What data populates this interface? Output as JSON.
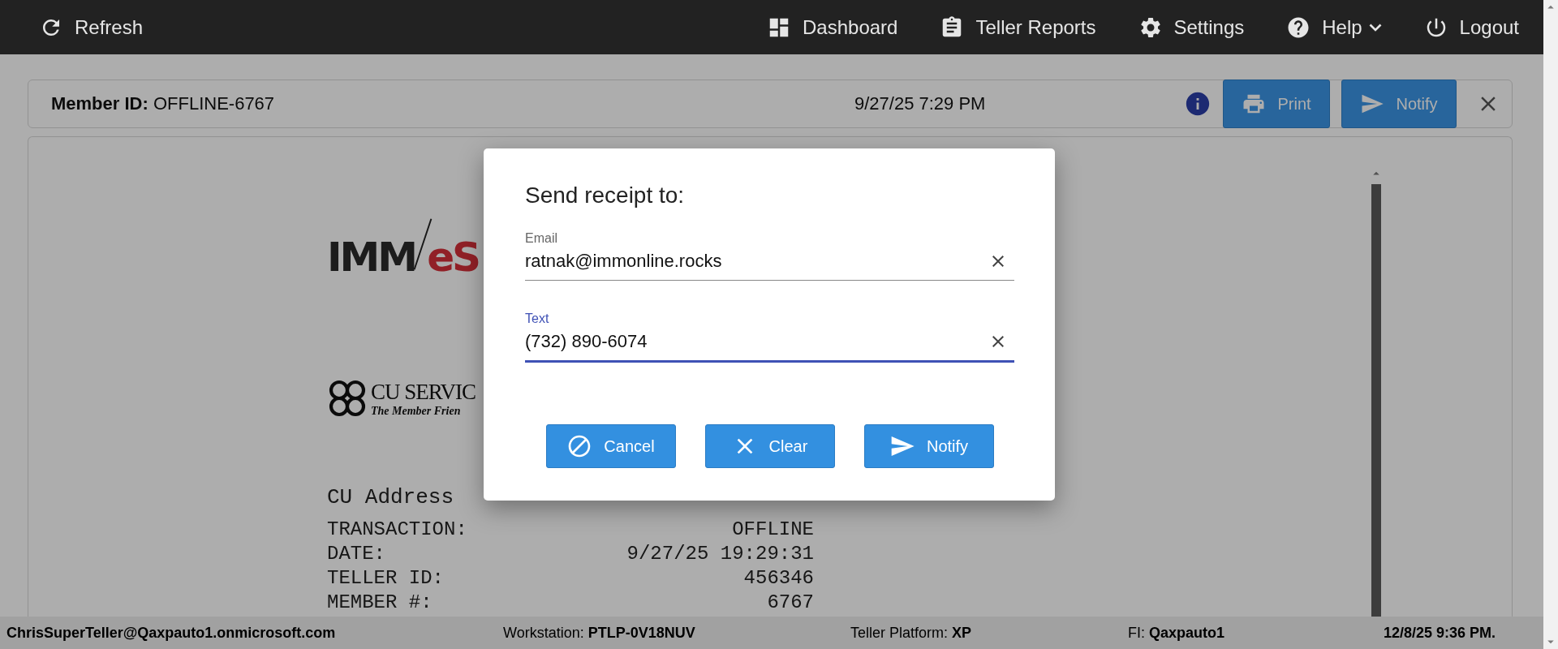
{
  "nav": {
    "refresh": {
      "label": "Refresh"
    },
    "items": [
      {
        "label": "Dashboard",
        "dropdown": false
      },
      {
        "label": "Teller Reports",
        "dropdown": false
      },
      {
        "label": "Settings",
        "dropdown": false
      },
      {
        "label": "Help",
        "dropdown": true
      },
      {
        "label": "Logout",
        "dropdown": false
      }
    ]
  },
  "header": {
    "member_label": "Member ID:",
    "member_id": "OFFLINE-6767",
    "datetime": "9/27/25 7:29 PM",
    "buttons": [
      {
        "label": "Print"
      },
      {
        "label": "Notify"
      }
    ]
  },
  "receipt": {
    "logo_left": "IMM",
    "logo_right": "eS",
    "cu_logo": {
      "name": "CU SERVIC",
      "tagline": "The Member Frien"
    },
    "address": "CU Address",
    "rows": [
      {
        "label": "TRANSACTION:",
        "value": "OFFLINE"
      },
      {
        "label": "DATE:",
        "value": "9/27/25 19:29:31"
      },
      {
        "label": "TELLER ID:",
        "value": "456346"
      },
      {
        "label": "MEMBER #:",
        "value": "6767"
      }
    ]
  },
  "dialog": {
    "title": "Send receipt to:",
    "fields": [
      {
        "label": "Email",
        "value": "ratnak@immonline.rocks",
        "focused": false
      },
      {
        "label": "Text",
        "value": "(732) 890-6074",
        "focused": true
      }
    ],
    "buttons": [
      {
        "label": "Cancel"
      },
      {
        "label": "Clear"
      },
      {
        "label": "Notify"
      }
    ]
  },
  "status_bar": [
    {
      "value": "ChrisSuperTeller@Qaxpauto1.onmicrosoft.com"
    },
    {
      "label": "Workstation:",
      "value": "PTLP-0V18NUV"
    },
    {
      "label": "Teller Platform:",
      "value": "XP"
    },
    {
      "label": "FI:",
      "value": "Qaxpauto1"
    },
    {
      "value": "12/8/25 9:36 PM."
    }
  ]
}
